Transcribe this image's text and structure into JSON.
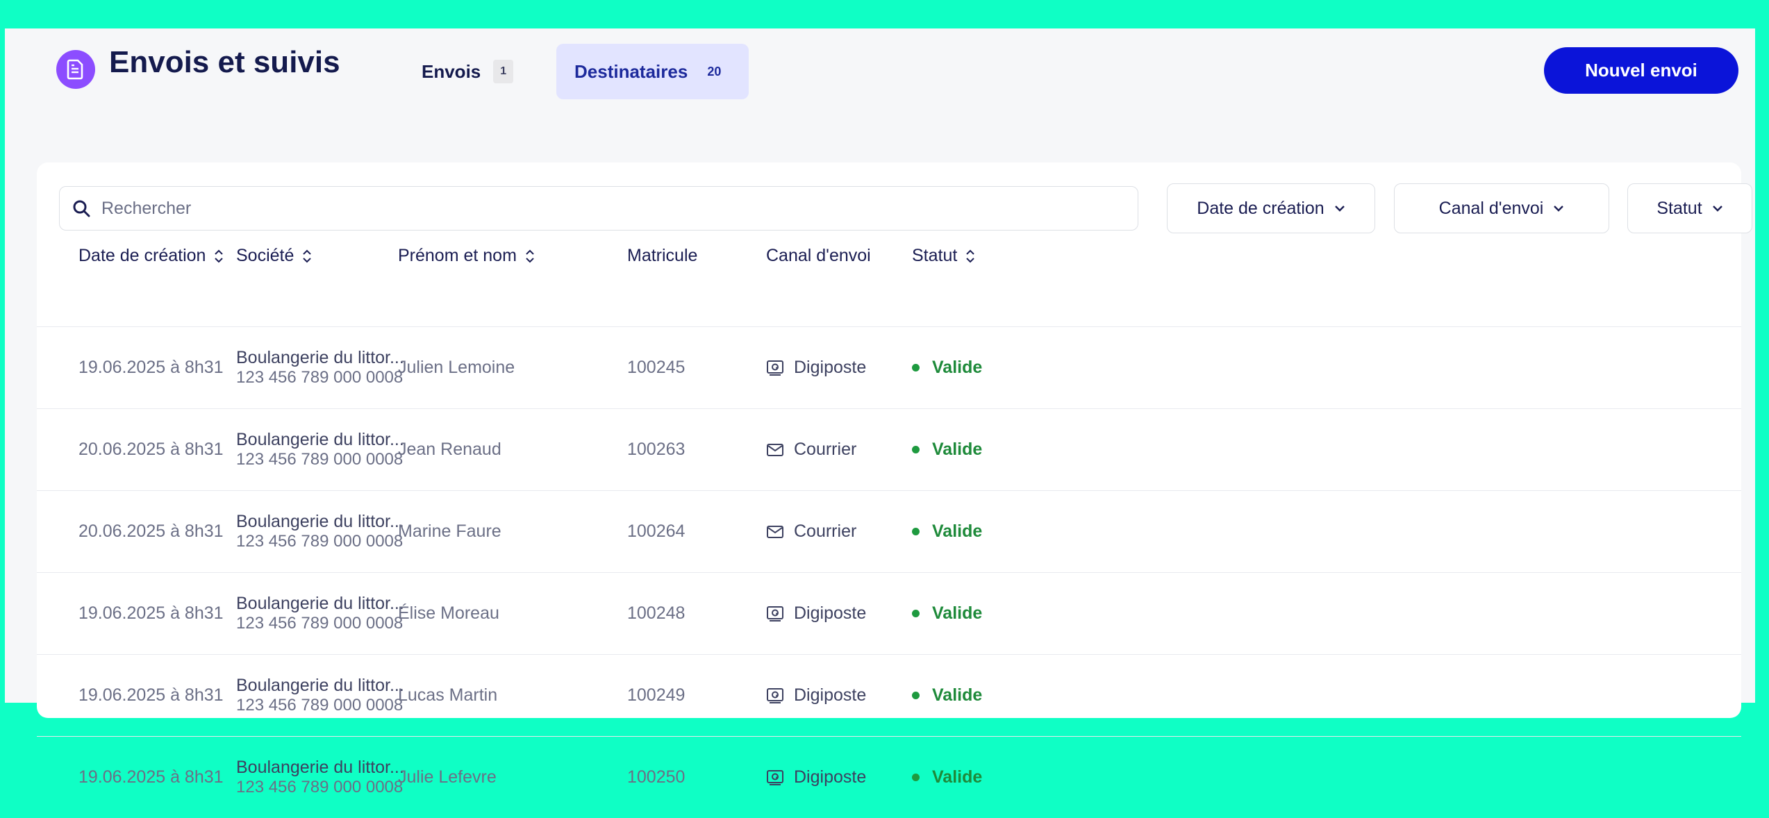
{
  "header": {
    "title": "Envois et suivis",
    "tabs": [
      {
        "label": "Envois",
        "count": "1",
        "active": false
      },
      {
        "label": "Destinataires",
        "count": "20",
        "active": true
      }
    ],
    "new_button": "Nouvel envoi"
  },
  "toolbar": {
    "search_placeholder": "Rechercher",
    "filters": [
      "Date de création",
      "Canal d'envoi",
      "Statut"
    ]
  },
  "table": {
    "columns": [
      "Date de création",
      "Société",
      "Prénom et nom",
      "Matricule",
      "Canal d'envoi",
      "Statut"
    ],
    "rows": [
      {
        "date": "19.06.2025 à 8h31",
        "company": "Boulangerie du littor...",
        "siret": "123 456 789 000 0008",
        "name": "Julien Lemoine",
        "matricule": "100245",
        "canal": "Digiposte",
        "canal_icon": "digiposte-icon",
        "status": "Valide"
      },
      {
        "date": "20.06.2025 à 8h31",
        "company": "Boulangerie du littor...",
        "siret": "123 456 789 000 0008",
        "name": "Jean Renaud",
        "matricule": "100263",
        "canal": "Courrier",
        "canal_icon": "mail-icon",
        "status": "Valide"
      },
      {
        "date": "20.06.2025 à 8h31",
        "company": "Boulangerie du littor...",
        "siret": "123 456 789 000 0008",
        "name": "Marine Faure",
        "matricule": "100264",
        "canal": "Courrier",
        "canal_icon": "mail-icon",
        "status": "Valide"
      },
      {
        "date": "19.06.2025 à 8h31",
        "company": "Boulangerie du littor...",
        "siret": "123 456 789 000 0008",
        "name": "Élise Moreau",
        "matricule": "100248",
        "canal": "Digiposte",
        "canal_icon": "digiposte-icon",
        "status": "Valide"
      },
      {
        "date": "19.06.2025 à 8h31",
        "company": "Boulangerie du littor...",
        "siret": "123 456 789 000 0008",
        "name": "Lucas Martin",
        "matricule": "100249",
        "canal": "Digiposte",
        "canal_icon": "digiposte-icon",
        "status": "Valide"
      },
      {
        "date": "19.06.2025 à 8h31",
        "company": "Boulangerie du littor...",
        "siret": "123 456 789 000 0008",
        "name": "Julie Lefevre",
        "matricule": "100250",
        "canal": "Digiposte",
        "canal_icon": "digiposte-icon",
        "status": "Valide"
      }
    ]
  },
  "colors": {
    "background": "#0fffc5",
    "primary": "#0b14d9",
    "logo": "#8c4dff",
    "status_valid": "#1e8a3a",
    "tab_active_bg": "#e2e4ff"
  }
}
